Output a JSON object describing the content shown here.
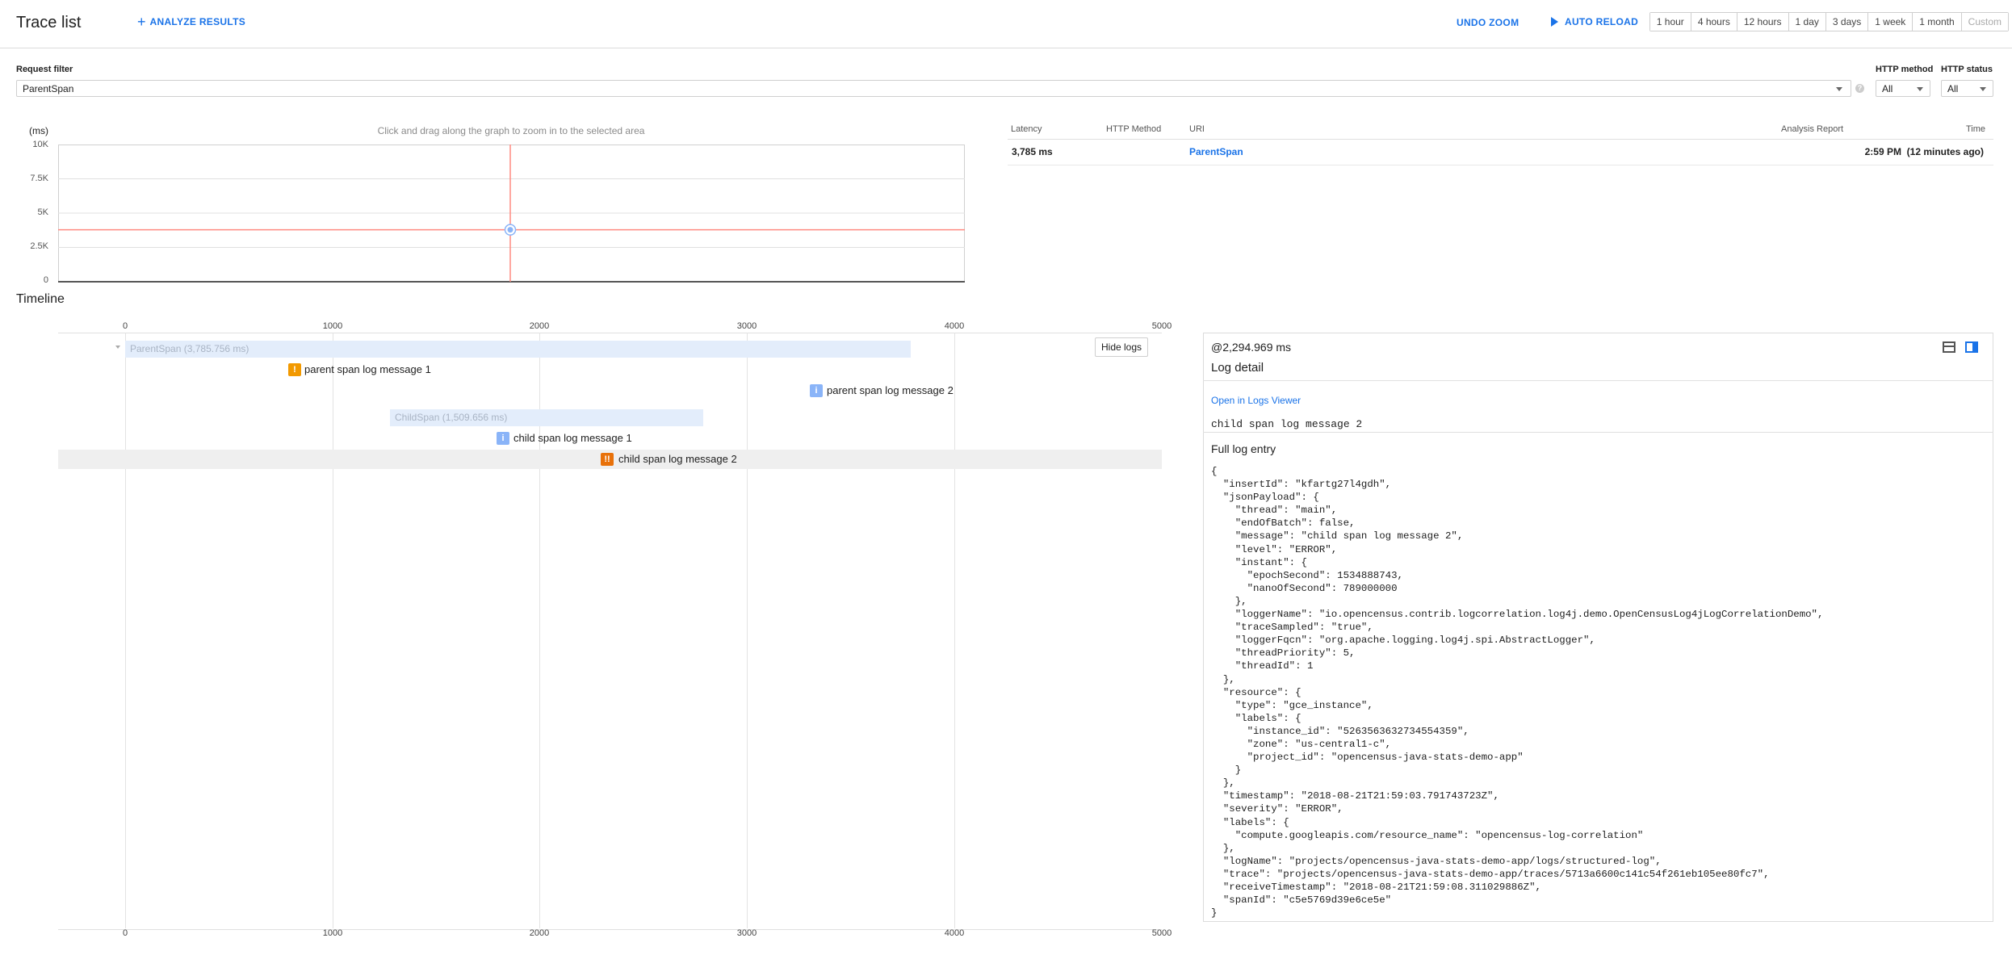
{
  "toolbar": {
    "title": "Trace list",
    "analyze_label": "ANALYZE RESULTS",
    "undo_zoom_label": "UNDO ZOOM",
    "auto_reload_label": "AUTO RELOAD",
    "time_ranges": [
      "1 hour",
      "4 hours",
      "12 hours",
      "1 day",
      "3 days",
      "1 week",
      "1 month",
      "Custom"
    ]
  },
  "filters": {
    "request_filter_label": "Request filter",
    "request_filter_value": "ParentSpan",
    "http_method_label": "HTTP method",
    "http_method_value": "All",
    "http_status_label": "HTTP status",
    "http_status_value": "All"
  },
  "chart": {
    "hint": "Click and drag along the graph to zoom in to the selected area",
    "unit_label": "(ms)",
    "y_ticks": [
      "10K",
      "7.5K",
      "5K",
      "2.5K",
      "0"
    ]
  },
  "chart_data": {
    "type": "scatter",
    "ylabel": "(ms)",
    "ylim": [
      0,
      10000
    ],
    "grid": true,
    "points": [
      {
        "latency_ms": 3785
      }
    ]
  },
  "results_table": {
    "headers": {
      "latency": "Latency",
      "method": "HTTP Method",
      "uri": "URI",
      "report": "Analysis Report",
      "time": "Time"
    },
    "row": {
      "latency": "3,785 ms",
      "method": "",
      "uri": "ParentSpan",
      "report": "",
      "time": "2:59 PM  (12 minutes ago)"
    }
  },
  "timeline": {
    "title": "Timeline",
    "axis_ticks": [
      "0",
      "1000",
      "2000",
      "3000",
      "4000",
      "5000"
    ],
    "hide_logs_label": "Hide logs",
    "parent_span_label": "ParentSpan (3,785.756 ms)",
    "child_span_label": "ChildSpan (1,509.656 ms)",
    "logs": [
      {
        "label": "parent span log message 1",
        "level": "warning",
        "icon": "!"
      },
      {
        "label": "parent span log message 2",
        "level": "info",
        "icon": "i"
      },
      {
        "label": "child span log message 1",
        "level": "info",
        "icon": "i"
      },
      {
        "label": "child span log message 2",
        "level": "error",
        "icon": "!!"
      }
    ],
    "colors": {
      "warning": "#f29900",
      "info": "#8ab4f8",
      "error": "#e8710a"
    }
  },
  "log_detail": {
    "offset": "@2,294.969 ms",
    "title": "Log detail",
    "open_link": "Open in Logs Viewer",
    "message": "child span log message 2",
    "full_entry_label": "Full log entry",
    "json": "{\n  \"insertId\": \"kfartg27l4gdh\",\n  \"jsonPayload\": {\n    \"thread\": \"main\",\n    \"endOfBatch\": false,\n    \"message\": \"child span log message 2\",\n    \"level\": \"ERROR\",\n    \"instant\": {\n      \"epochSecond\": 1534888743,\n      \"nanoOfSecond\": 789000000\n    },\n    \"loggerName\": \"io.opencensus.contrib.logcorrelation.log4j.demo.OpenCensusLog4jLogCorrelationDemo\",\n    \"traceSampled\": \"true\",\n    \"loggerFqcn\": \"org.apache.logging.log4j.spi.AbstractLogger\",\n    \"threadPriority\": 5,\n    \"threadId\": 1\n  },\n  \"resource\": {\n    \"type\": \"gce_instance\",\n    \"labels\": {\n      \"instance_id\": \"5263563632734554359\",\n      \"zone\": \"us-central1-c\",\n      \"project_id\": \"opencensus-java-stats-demo-app\"\n    }\n  },\n  \"timestamp\": \"2018-08-21T21:59:03.791743723Z\",\n  \"severity\": \"ERROR\",\n  \"labels\": {\n    \"compute.googleapis.com/resource_name\": \"opencensus-log-correlation\"\n  },\n  \"logName\": \"projects/opencensus-java-stats-demo-app/logs/structured-log\",\n  \"trace\": \"projects/opencensus-java-stats-demo-app/traces/5713a6600c141c54f261eb105ee80fc7\",\n  \"receiveTimestamp\": \"2018-08-21T21:59:08.311029886Z\",\n  \"spanId\": \"c5e5769d39e6ce5e\"\n}"
  }
}
